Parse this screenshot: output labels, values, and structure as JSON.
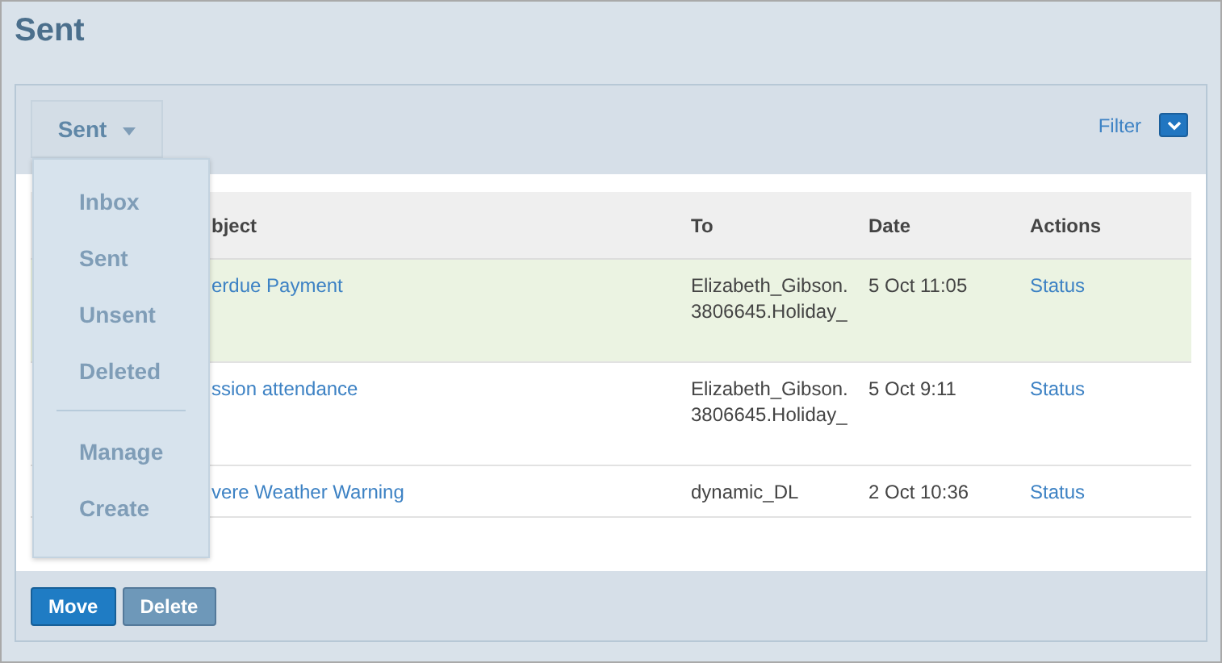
{
  "page": {
    "title": "Sent"
  },
  "folder_button": {
    "label": "Sent"
  },
  "filter": {
    "label": "Filter"
  },
  "menu": {
    "groups": [
      [
        "Inbox",
        "Sent",
        "Unsent",
        "Deleted"
      ],
      [
        "Manage",
        "Create"
      ]
    ]
  },
  "table": {
    "columns": [
      "bject",
      "To",
      "Date",
      "Actions"
    ],
    "rows": [
      {
        "subject": "erdue Payment",
        "to": "Elizabeth_Gibson.\n3806645.Holiday_",
        "date": "5 Oct 11:05",
        "action": "Status",
        "highlighted": true
      },
      {
        "subject": "ssion attendance",
        "to": "Elizabeth_Gibson.\n3806645.Holiday_",
        "date": "5 Oct 9:11",
        "action": "Status",
        "highlighted": false
      },
      {
        "subject": "vere Weather Warning",
        "to": "dynamic_DL",
        "date": "2 Oct 10:36",
        "action": "Status",
        "highlighted": false
      }
    ]
  },
  "buttons": [
    {
      "label": "Move",
      "kind": "primary"
    },
    {
      "label": "Delete",
      "kind": "secondary"
    }
  ]
}
